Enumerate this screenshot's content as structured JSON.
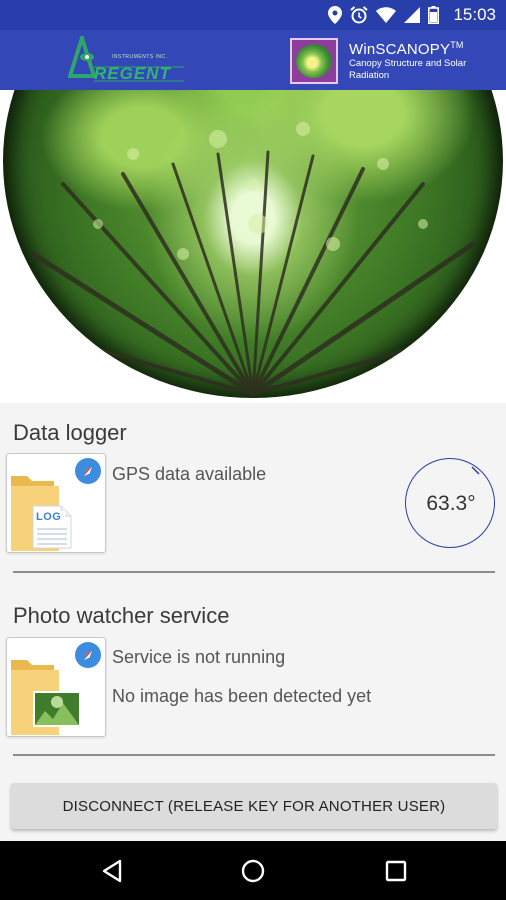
{
  "status_bar": {
    "time": "15:03",
    "icons": [
      "location-icon",
      "alarm-icon",
      "wifi-icon",
      "signal-icon",
      "battery-icon"
    ]
  },
  "header": {
    "brand_logo_text": "REGENT",
    "brand_logo_small_text": "INSTRUMENTS INC.",
    "app_title": "WinSCANOPY",
    "app_title_mark": "TM",
    "app_subtitle": "Canopy Structure and Solar Radiation"
  },
  "data_logger": {
    "title": "Data logger",
    "thumb_label": "LOG",
    "status": "GPS data available",
    "angle": "63.3°"
  },
  "photo_watcher": {
    "title": "Photo watcher service",
    "status": "Service is not running",
    "detail": "No image has been detected yet"
  },
  "actions": {
    "disconnect_label": "DISCONNECT (RELEASE KEY FOR ANOTHER USER)"
  },
  "nav": {
    "icons": [
      "back-icon",
      "home-icon",
      "recents-icon"
    ]
  },
  "colors": {
    "status_bar": "#283fab",
    "header": "#3348b6",
    "accent": "#2b3eaa",
    "badge": "#3c8de0"
  }
}
